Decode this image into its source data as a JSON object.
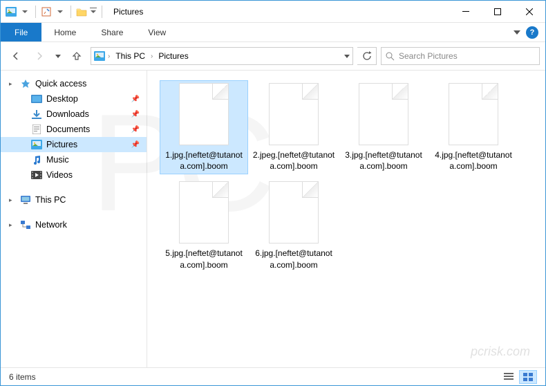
{
  "window": {
    "title": "Pictures"
  },
  "ribbon": {
    "file": "File",
    "tabs": [
      "Home",
      "Share",
      "View"
    ]
  },
  "breadcrumb": {
    "items": [
      "This PC",
      "Pictures"
    ]
  },
  "search": {
    "placeholder": "Search Pictures"
  },
  "sidebar": {
    "quick_access": {
      "label": "Quick access",
      "items": [
        {
          "label": "Desktop",
          "icon": "desktop",
          "pinned": true
        },
        {
          "label": "Downloads",
          "icon": "downloads",
          "pinned": true
        },
        {
          "label": "Documents",
          "icon": "documents",
          "pinned": true
        },
        {
          "label": "Pictures",
          "icon": "pictures",
          "pinned": true,
          "selected": true
        },
        {
          "label": "Music",
          "icon": "music",
          "pinned": false
        },
        {
          "label": "Videos",
          "icon": "videos",
          "pinned": false
        }
      ]
    },
    "this_pc": {
      "label": "This PC"
    },
    "network": {
      "label": "Network"
    }
  },
  "files": [
    {
      "name": "1.jpg.[neftet@tutanota.com].boom",
      "selected": true
    },
    {
      "name": "2.jpeg.[neftet@tutanota.com].boom",
      "selected": false
    },
    {
      "name": "3.jpg.[neftet@tutanota.com].boom",
      "selected": false
    },
    {
      "name": "4.jpg.[neftet@tutanota.com].boom",
      "selected": false
    },
    {
      "name": "5.jpg.[neftet@tutanota.com].boom",
      "selected": false
    },
    {
      "name": "6.jpg.[neftet@tutanota.com].boom",
      "selected": false
    }
  ],
  "statusbar": {
    "count": "6 items"
  },
  "watermark": {
    "main": "PC",
    "sub": "pcrisk.com"
  }
}
